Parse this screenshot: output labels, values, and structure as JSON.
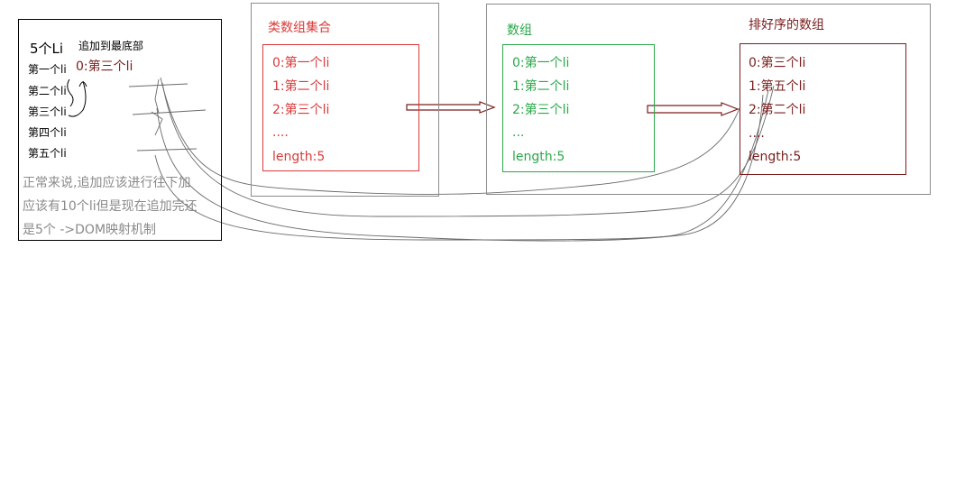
{
  "colors": {
    "black": "#000000",
    "gray_border": "#8c8c8c",
    "gray_text": "#8a8a8a",
    "red": "#d93a3a",
    "green": "#2aa84a",
    "maroon": "#7a1d1d",
    "pencil": "#6a6a6a"
  },
  "left_panel": {
    "title": "5个Li",
    "append_label": "追加到最底部",
    "appended_item": "0:第三个li",
    "items": [
      "第一个li",
      "第二个li",
      "第三个li",
      "第四个li",
      "第五个li"
    ],
    "note_lines": [
      "正常来说,追加应该进行往下加",
      "应该有10个li但是现在追加完还",
      "是5个  ->DOM映射机制"
    ]
  },
  "array_like": {
    "title": "类数组集合",
    "items": [
      "0:第一个li",
      "1:第二个li",
      "2:第三个li",
      "....",
      "length:5"
    ]
  },
  "array": {
    "title": "数组",
    "items": [
      "0:第一个li",
      "1:第二个li",
      "2:第三个li",
      "...",
      "length:5"
    ]
  },
  "sorted_array": {
    "title": "排好序的数组",
    "items": [
      "0:第三个li",
      "1:第五个li",
      "2:第二个li",
      "....",
      "length:5"
    ]
  }
}
